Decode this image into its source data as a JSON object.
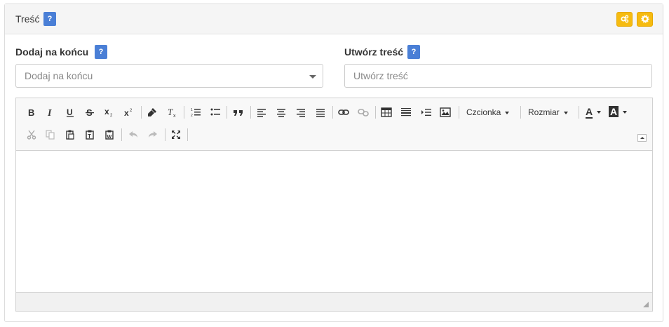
{
  "panel": {
    "title": "Treść",
    "help_glyph": "?",
    "actions": [
      {
        "icon": "gears-icon",
        "color": "#f6bb10"
      },
      {
        "icon": "gear-icon",
        "color": "#f6bb10"
      }
    ]
  },
  "fields": {
    "append": {
      "label": "Dodaj na końcu",
      "placeholder": "Dodaj na końcu",
      "help_glyph": "?"
    },
    "create": {
      "label": "Utwórz treść",
      "placeholder": "Utwórz treść",
      "help_glyph": "?"
    }
  },
  "editor": {
    "toolbar": {
      "row1": [
        "bold-icon",
        "italic-icon",
        "underline-icon",
        "strikethrough-icon",
        "subscript-icon",
        "superscript-icon",
        "copy-formatting-icon",
        "remove-format-icon",
        "numbered-list-icon",
        "bulleted-list-icon",
        "blockquote-icon",
        "align-left-icon",
        "align-center-icon",
        "align-right-icon",
        "justify-icon",
        "link-icon",
        "unlink-icon",
        "table-icon",
        "horizontal-line-icon",
        "page-break-icon",
        "image-icon"
      ],
      "font_label": "Czcionka",
      "size_label": "Rozmiar",
      "text_color_glyph": "A",
      "bg_color_glyph": "A",
      "row2": [
        "cut-icon",
        "copy-icon",
        "paste-icon",
        "paste-text-icon",
        "paste-word-icon",
        "undo-icon",
        "redo-icon",
        "maximize-icon"
      ]
    },
    "accent_color": "#4a7fd6"
  }
}
